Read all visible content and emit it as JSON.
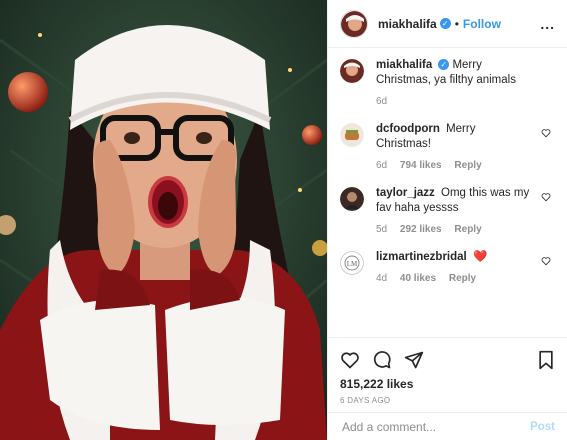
{
  "header": {
    "username": "miakhalifa",
    "verified_icon": "verified-badge-icon",
    "separator": "•",
    "follow_label": "Follow",
    "more_label": "..."
  },
  "caption": {
    "username": "miakhalifa",
    "text": "Merry Christmas, ya filthy animals",
    "time": "6d"
  },
  "comments": [
    {
      "username": "dcfoodporn",
      "text": "Merry Christmas!",
      "time": "6d",
      "likes": "794 likes",
      "reply": "Reply"
    },
    {
      "username": "taylor_jazz",
      "text": "Omg this was my fav haha yessss",
      "time": "5d",
      "likes": "292 likes",
      "reply": "Reply"
    },
    {
      "username": "lizmartinezbridal",
      "text": "❤️",
      "time": "4d",
      "likes": "40 likes",
      "reply": "Reply"
    }
  ],
  "post": {
    "likes": "815,222 likes",
    "date": "6 DAYS AGO"
  },
  "add_comment": {
    "placeholder": "Add a comment...",
    "post_label": "Post"
  },
  "colors": {
    "accent": "#3897f0",
    "post_disabled": "#b3dbff",
    "muted": "#8e8e8e"
  }
}
